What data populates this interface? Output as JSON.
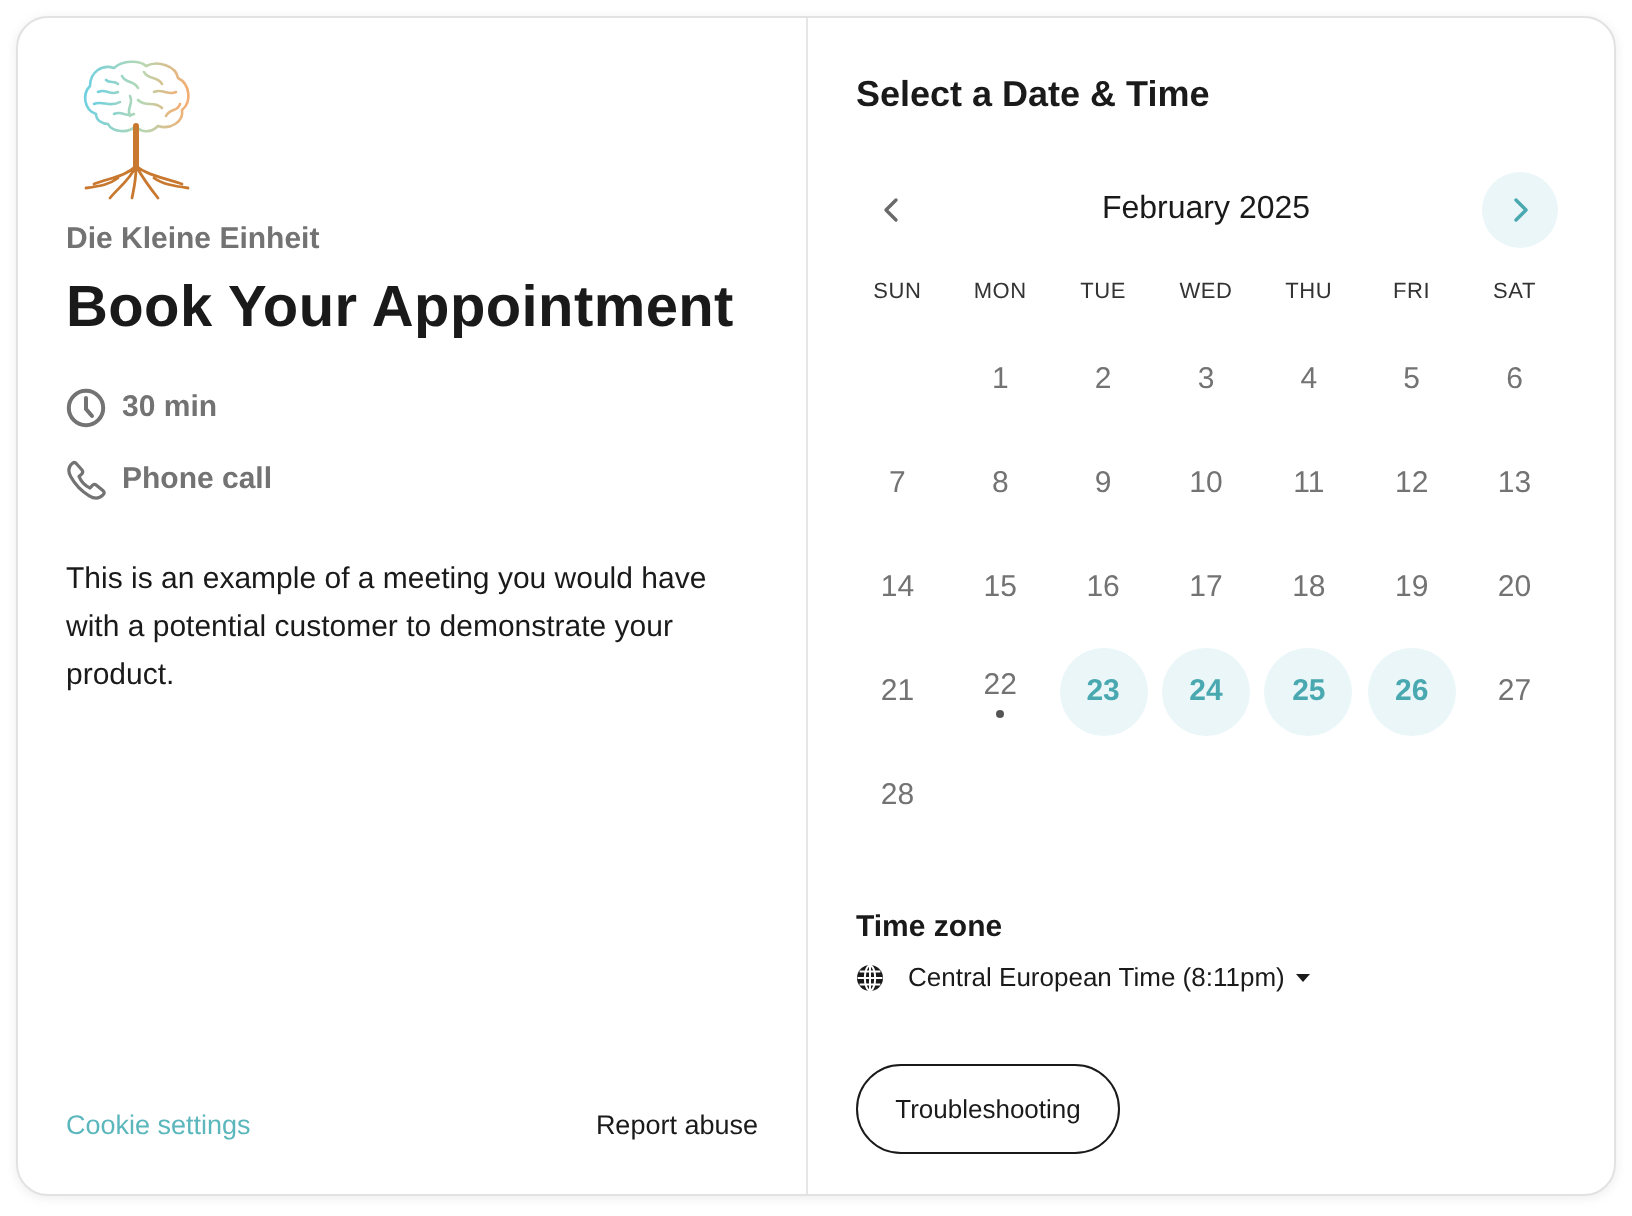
{
  "organizer": "Die Kleine Einheit",
  "title": "Book Your Appointment",
  "details": [
    {
      "kind": "duration",
      "text": "30 min"
    },
    {
      "kind": "phone",
      "text": "Phone call"
    }
  ],
  "description": "This is an example of a meeting you would have with a potential customer to demonstrate your product.",
  "footer": {
    "cookie_link": "Cookie settings",
    "report_link": "Report abuse"
  },
  "scheduler": {
    "heading": "Select a Date & Time",
    "month": "February 2025",
    "prev_disabled": true,
    "next_disabled": false,
    "weekdays": [
      "SUN",
      "MON",
      "TUE",
      "WED",
      "THU",
      "FRI",
      "SAT"
    ],
    "weeks": [
      [
        {
          "label": "1",
          "available": false,
          "today": false
        },
        {
          "label": "2",
          "available": false,
          "today": false
        },
        {
          "label": "3",
          "available": false,
          "today": false
        },
        {
          "label": "4",
          "available": false,
          "today": false
        },
        {
          "label": "5",
          "available": false,
          "today": false
        },
        {
          "label": "6",
          "available": false,
          "today": false
        }
      ],
      [
        {
          "label": "7",
          "available": false,
          "today": false
        },
        {
          "label": "8",
          "available": false,
          "today": false
        },
        {
          "label": "9",
          "available": false,
          "today": false
        },
        {
          "label": "10",
          "available": false,
          "today": false
        },
        {
          "label": "11",
          "available": false,
          "today": false
        },
        {
          "label": "12",
          "available": false,
          "today": false
        },
        {
          "label": "13",
          "available": false,
          "today": false
        }
      ],
      [
        {
          "label": "14",
          "available": false,
          "today": false
        },
        {
          "label": "15",
          "available": false,
          "today": false
        },
        {
          "label": "16",
          "available": false,
          "today": false
        },
        {
          "label": "17",
          "available": false,
          "today": false
        },
        {
          "label": "18",
          "available": false,
          "today": false
        },
        {
          "label": "19",
          "available": false,
          "today": false
        },
        {
          "label": "20",
          "available": false,
          "today": false
        }
      ],
      [
        {
          "label": "21",
          "available": false,
          "today": false
        },
        {
          "label": "22",
          "available": false,
          "today": true
        },
        {
          "label": "23",
          "available": true,
          "today": false
        },
        {
          "label": "24",
          "available": true,
          "today": false
        },
        {
          "label": "25",
          "available": true,
          "today": false
        },
        {
          "label": "26",
          "available": true,
          "today": false
        },
        {
          "label": "27",
          "available": false,
          "today": false
        }
      ],
      [
        {
          "label": "28",
          "available": false,
          "today": false
        }
      ]
    ]
  },
  "time_zone": {
    "label": "Time zone",
    "value": "Central European Time (8:11pm)"
  },
  "button": "Troubleshooting"
}
